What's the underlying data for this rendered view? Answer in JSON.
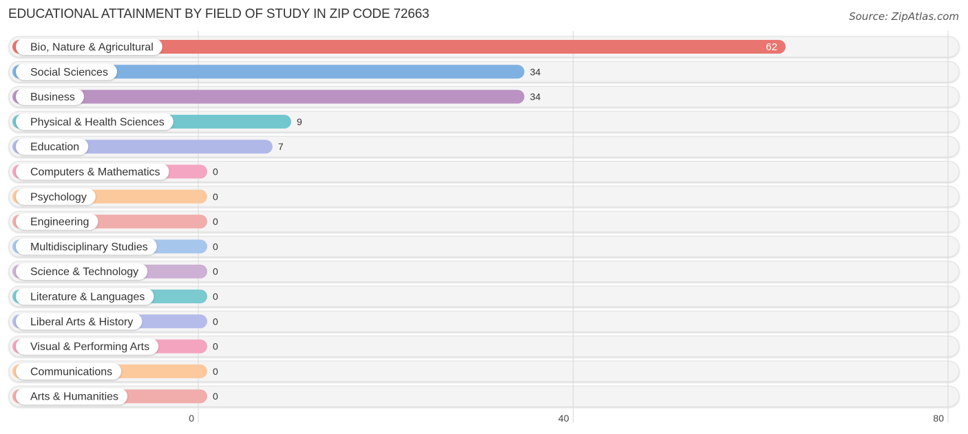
{
  "header": {
    "title": "EDUCATIONAL ATTAINMENT BY FIELD OF STUDY IN ZIP CODE 72663",
    "source": "Source: ZipAtlas.com"
  },
  "chart_data": {
    "type": "bar",
    "orientation": "horizontal",
    "title": "EDUCATIONAL ATTAINMENT BY FIELD OF STUDY IN ZIP CODE 72663",
    "xlabel": "",
    "ylabel": "",
    "categories": [
      "Bio, Nature & Agricultural",
      "Social Sciences",
      "Business",
      "Physical & Health Sciences",
      "Education",
      "Computers & Mathematics",
      "Psychology",
      "Engineering",
      "Multidisciplinary Studies",
      "Science & Technology",
      "Literature & Languages",
      "Liberal Arts & History",
      "Visual & Performing Arts",
      "Communications",
      "Arts & Humanities"
    ],
    "values": [
      62,
      34,
      34,
      9,
      7,
      0,
      0,
      0,
      0,
      0,
      0,
      0,
      0,
      0,
      0
    ],
    "value_labels": [
      "62",
      "34",
      "34",
      "9",
      "7",
      "0",
      "0",
      "0",
      "0",
      "0",
      "0",
      "0",
      "0",
      "0",
      "0"
    ],
    "colors": [
      "#e8756f",
      "#7fb0e2",
      "#bb93c2",
      "#72c6ce",
      "#b0b8e8",
      "#f4a5c1",
      "#fbc99c",
      "#f0adab",
      "#a7c6ec",
      "#ccb1d4",
      "#7acad0",
      "#b5bcea",
      "#f5a4bf",
      "#fbc99c",
      "#f0adab"
    ],
    "xlim": [
      0,
      80
    ],
    "xticks": [
      0,
      40,
      80
    ],
    "xtick_labels": [
      "0",
      "40",
      "80"
    ],
    "grid": true,
    "legend": "none"
  }
}
